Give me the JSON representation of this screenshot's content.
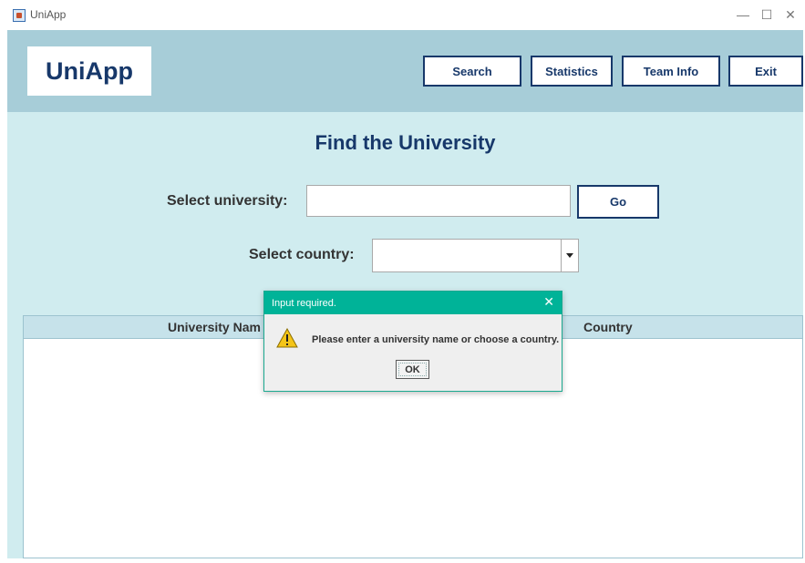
{
  "window": {
    "title": "UniApp",
    "minimize_symbol": "—",
    "maximize_symbol": "☐",
    "close_symbol": "✕",
    "icon": "java-app-icon"
  },
  "header": {
    "logo_text": "UniApp",
    "nav": {
      "search_label": "Search",
      "statistics_label": "Statistics",
      "team_info_label": "Team Info",
      "exit_label": "Exit"
    }
  },
  "search": {
    "page_title": "Find the University",
    "university_label": "Select university:",
    "university_value": "",
    "go_label": "Go",
    "country_label": "Select country:",
    "country_selected": ""
  },
  "table": {
    "columns": [
      "University Nam",
      "Country"
    ],
    "rows": []
  },
  "dialog": {
    "title": "Input required.",
    "close_symbol": "✕",
    "message": "Please enter a university name or choose a country.",
    "ok_label": "OK",
    "icon": "warning-icon"
  },
  "colors": {
    "brand": "#17386a",
    "header_bg": "#a7cdd8",
    "content_bg": "#d0ecef",
    "dialog_title_bg": "#00b398",
    "warning_yellow": "#f5c518"
  }
}
